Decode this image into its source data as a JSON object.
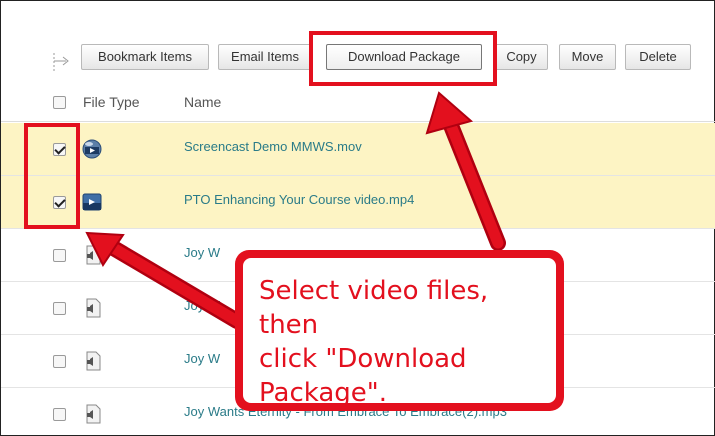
{
  "toolbar": {
    "buttons": [
      {
        "id": "bookmark",
        "label": "Bookmark Items"
      },
      {
        "id": "email",
        "label": "Email Items"
      },
      {
        "id": "download",
        "label": "Download Package"
      },
      {
        "id": "copy",
        "label": "Copy"
      },
      {
        "id": "move",
        "label": "Move"
      },
      {
        "id": "delete",
        "label": "Delete"
      }
    ]
  },
  "table": {
    "headers": {
      "file_type": "File Type",
      "name": "Name"
    },
    "rows": [
      {
        "name": "Screencast Demo MMWS.mov",
        "checked": true,
        "icon": "video-file-icon"
      },
      {
        "name": "PTO Enhancing Your Course video.mp4",
        "checked": true,
        "icon": "video-file-icon"
      },
      {
        "name": "Joy W",
        "checked": false,
        "icon": "audio-file-icon"
      },
      {
        "name": "Joy W",
        "checked": false,
        "icon": "audio-file-icon"
      },
      {
        "name": "Joy W",
        "checked": false,
        "icon": "audio-file-icon"
      },
      {
        "name": "Joy Wants Eternity - From Embrace To Embrace(2).mp3",
        "checked": false,
        "icon": "audio-file-icon"
      }
    ]
  },
  "annotation": {
    "callout_line1": "Select video files, then",
    "callout_line2": "click \"Download",
    "callout_line3": "Package\"."
  },
  "colors": {
    "annotation_red": "#e3101e",
    "selected_row": "#fdf4c4",
    "link_teal": "#2a7b88"
  }
}
